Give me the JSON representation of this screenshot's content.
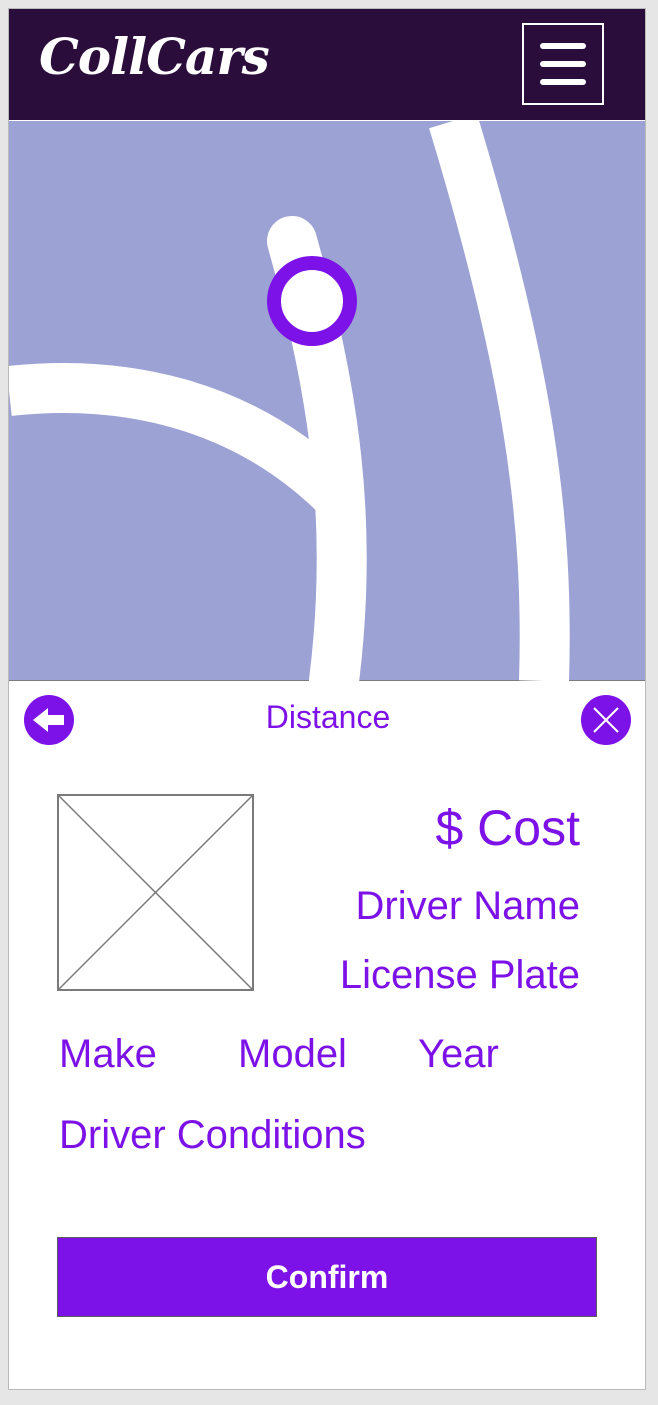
{
  "header": {
    "logo": "CollCars",
    "menu_icon": "hamburger-menu-icon",
    "background_color": "#2a0d3a"
  },
  "map": {
    "background_color": "#9ca2d4",
    "marker_icon": "location-ring-icon",
    "marker_color": "#7d12e8"
  },
  "panel": {
    "title": "Distance",
    "back_icon": "arrow-left-circle-icon",
    "close_icon": "close-circle-icon",
    "photo": "image-placeholder-icon",
    "cost": "$ Cost",
    "driver_name": "Driver Name",
    "license_plate": "License Plate",
    "make": "Make",
    "model": "Model",
    "year": "Year",
    "driver_conditions": "Driver Conditions",
    "confirm_label": "Confirm",
    "accent_color": "#7d12e8"
  }
}
